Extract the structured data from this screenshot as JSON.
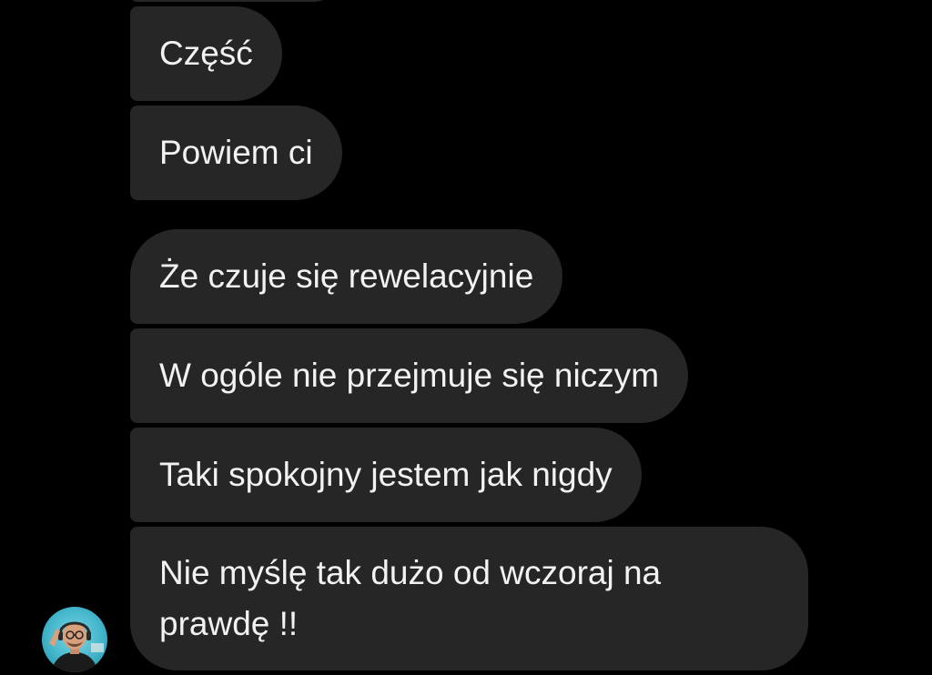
{
  "conversation": {
    "messages": [
      {
        "text": "Część"
      },
      {
        "text": "Powiem ci"
      },
      {
        "text": "Że czuje się rewelacyjnie"
      },
      {
        "text": "W ogóle nie przejmuje się niczym"
      },
      {
        "text": "Taki spokojny jestem jak nigdy"
      },
      {
        "text": "Nie myślę tak dużo od wczoraj na prawdę !!"
      }
    ],
    "sender": {
      "avatar_icon": "user-avatar-photo"
    }
  },
  "colors": {
    "background": "#000000",
    "bubble": "#262626",
    "text": "#f2f2f2",
    "avatar_accent": "#3fb2c8"
  }
}
